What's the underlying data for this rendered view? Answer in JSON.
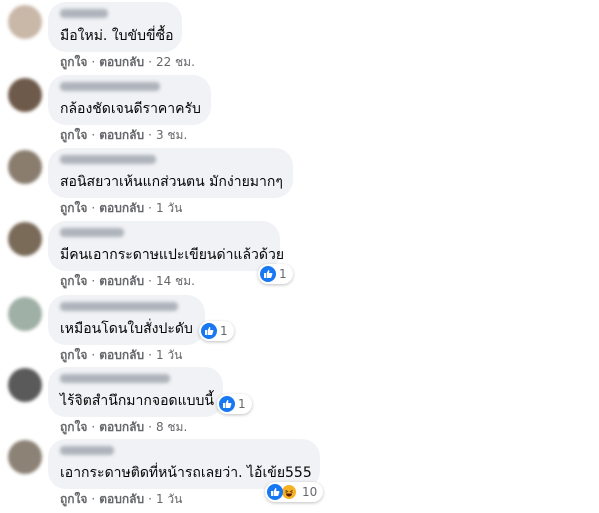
{
  "comments": [
    {
      "text": "มือใหม่. ใบขับขี่ซื้อ",
      "like": "ถูกใจ",
      "reply": "ตอบกลับ",
      "time": "22 ชม.",
      "avatar_color": "#c9b8a8",
      "reactions": null
    },
    {
      "text": "กล้องชัดเจนดีราคาครับ",
      "like": "ถูกใจ",
      "reply": "ตอบกลับ",
      "time": "3 ชม.",
      "avatar_color": "#6e5a4a",
      "reactions": null
    },
    {
      "text": "สอนิสยวาเห้นแกส่วนตน มักง่ายมากๆ",
      "like": "ถูกใจ",
      "reply": "ตอบกลับ",
      "time": "1 วัน",
      "avatar_color": "#8a7d6e",
      "reactions": null
    },
    {
      "text": "มีคนเอากระดาษแปะเขียนด่าแล้วด้วย",
      "like": "ถูกใจ",
      "reply": "ตอบกลับ",
      "time": "14 ชม.",
      "avatar_color": "#7a6a58",
      "reactions": {
        "count": "1",
        "types": [
          "like"
        ]
      }
    },
    {
      "text": "เหมือนโดนใบสั่งปะดับ",
      "like": "ถูกใจ",
      "reply": "ตอบกลับ",
      "time": "1 วัน",
      "avatar_color": "#9fb0a6",
      "reactions": {
        "count": "1",
        "types": [
          "like"
        ]
      }
    },
    {
      "text": "ไร้จิตสำนึกมากจอดแบบนี้",
      "like": "ถูกใจ",
      "reply": "ตอบกลับ",
      "time": "8 ชม.",
      "avatar_color": "#5a5a5a",
      "reactions": {
        "count": "1",
        "types": [
          "like"
        ]
      }
    },
    {
      "text": "เอากระดาษติดที่หน้ารถเลยว่า. ไอ้เข้ย555",
      "like": "ถูกใจ",
      "reply": "ตอบกลับ",
      "time": "1 วัน",
      "avatar_color": "#8c8275",
      "reactions": {
        "count": "10",
        "types": [
          "like",
          "haha"
        ]
      }
    }
  ],
  "colors": {
    "bubble": "#f0f2f5",
    "meta_text": "#65676b",
    "like_blue": "#1877f2",
    "haha_yellow": "#f7b125"
  }
}
